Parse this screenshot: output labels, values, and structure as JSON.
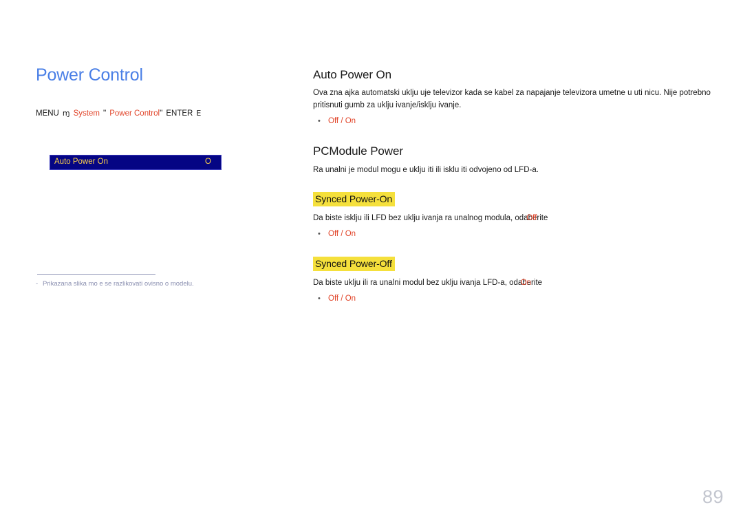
{
  "document": {
    "page_number": "89"
  },
  "left": {
    "title": "Power Control",
    "breadcrumb": {
      "menu_label": "MENU",
      "menu_glyph": "ɱ",
      "item1": "System",
      "quote_open": "\"",
      "item2": "Power Control",
      "quote_close": "\"",
      "enter_label": "ENTER",
      "enter_glyph": "E"
    },
    "osd": {
      "label": "Auto Power On",
      "value": "O"
    },
    "footnote": {
      "dash": "-",
      "text": "Prikazana slika mo e se razlikovati ovisno o modelu."
    }
  },
  "right": {
    "section1": {
      "heading": "Auto Power On",
      "paragraph": "Ova zna ajka automatski uklju uje televizor kada se kabel za napajanje televizora umetne u uti nicu. Nije potrebno pritisnuti gumb za uklju ivanje/isklju ivanje.",
      "bullet_dot": "•",
      "bullet": "Off / On"
    },
    "section2": {
      "heading": "PCModule Power",
      "paragraph": "Ra unalni je modul mogu e uklju iti ili isklu iti odvojeno od LFD-a.",
      "sub1": {
        "heading": "Synced Power-On",
        "paragraph": "Da biste isklju ili LFD bez uklju ivanja ra unalnog modula, odaberite",
        "overlap_token": "Off",
        "bullet_dot": "•",
        "bullet": "Off / On"
      },
      "sub2": {
        "heading": "Synced Power-Off",
        "paragraph": "Da biste uklju ili ra unalni modul bez uklju ivanja LFD-a, odaberite",
        "overlap_token": "On",
        "bullet_dot": "•",
        "bullet": "Off / On"
      }
    }
  }
}
